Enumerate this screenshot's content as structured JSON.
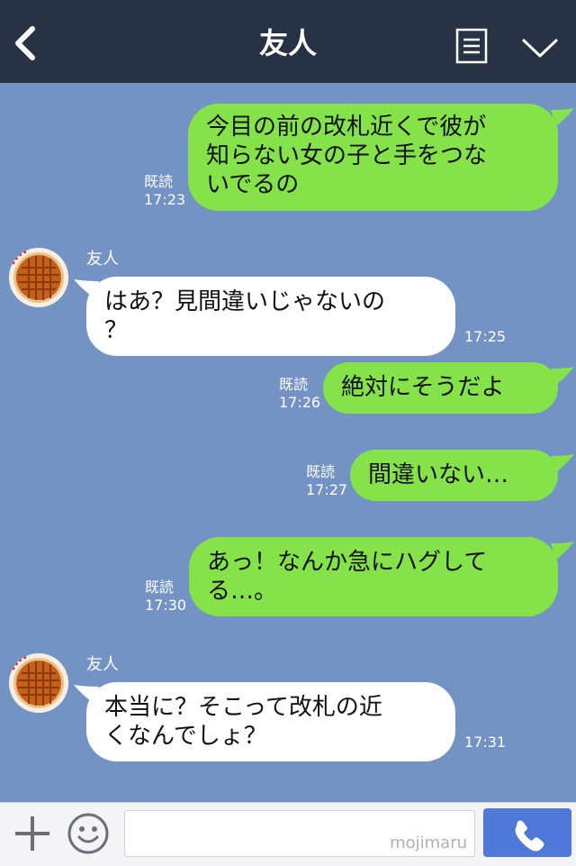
{
  "header": {
    "title": "友人",
    "back_icon": "chevron-left-icon",
    "menu_icon": "memo-icon",
    "more_icon": "chevron-down-icon"
  },
  "messages": [
    {
      "type": "sent",
      "text": "今目の前の改札近くで彼が\n知らない女の子と手をつな\nいでるの",
      "read": "既読",
      "time": "17:23"
    },
    {
      "type": "received",
      "sender": "友人",
      "text": "はあ？見間違いじゃないの\n？",
      "time": "17:25"
    },
    {
      "type": "sent",
      "text": "絶対にそうだよ",
      "read": "既読",
      "time": "17:26"
    },
    {
      "type": "sent",
      "text": "間違いない…",
      "read": "既読",
      "time": "17:27"
    },
    {
      "type": "sent",
      "text": "あっ！なんか急にハグして\nる…。",
      "read": "既読",
      "time": "17:30"
    },
    {
      "type": "received",
      "sender": "友人",
      "text": "本当に？そこって改札の近\nくなんでしょ？",
      "time": "17:31"
    }
  ],
  "footer": {
    "plus_icon": "plus-icon",
    "emoji_icon": "smiley-icon",
    "input_placeholder": "",
    "watermark": "mojimaru",
    "call_icon": "phone-icon"
  },
  "colors": {
    "background": "#7393c4",
    "header": "#273244",
    "sent_bubble": "#85e249",
    "received_bubble": "#ffffff",
    "call_button": "#4f79d8"
  }
}
